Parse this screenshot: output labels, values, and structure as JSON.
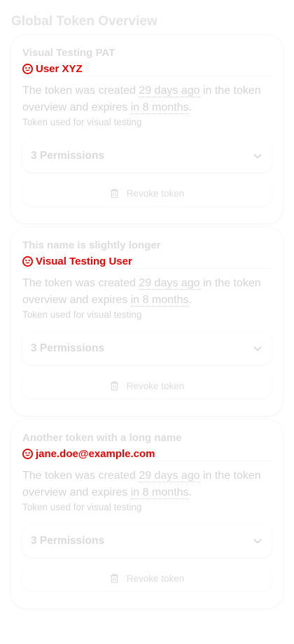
{
  "page": {
    "title": "Global Token Overview"
  },
  "colors": {
    "owner_accent": "#ee0000",
    "muted_text": "#d4d4d4"
  },
  "tokens": [
    {
      "name": "Visual Testing PAT",
      "owner": "User XYZ",
      "desc_prefix": "The token was created ",
      "created": "29 days ago",
      "desc_middle": " in the token overview and expires ",
      "expires": "in 8 months",
      "desc_suffix": ".",
      "note": "Token used for visual testing",
      "permissions_label": "3 Permissions",
      "revoke_label": "Revoke token"
    },
    {
      "name": "This name is slightly longer",
      "owner": "Visual Testing User",
      "desc_prefix": "The token was created ",
      "created": "29 days ago",
      "desc_middle": " in the token overview and expires ",
      "expires": "in 8 months",
      "desc_suffix": ".",
      "note": "Token used for visual testing",
      "permissions_label": "3 Permissions",
      "revoke_label": "Revoke token"
    },
    {
      "name": "Another token with a long name",
      "owner": "jane.doe@example.com",
      "desc_prefix": "The token was created ",
      "created": "29 days ago",
      "desc_middle": " in the token overview and expires ",
      "expires": "in 8 months",
      "desc_suffix": ".",
      "note": "Token used for visual testing",
      "permissions_label": "3 Permissions",
      "revoke_label": "Revoke token"
    }
  ],
  "icons": {
    "owner": "user-face-icon",
    "expand": "chevron-down-icon",
    "revoke": "trash-icon"
  }
}
